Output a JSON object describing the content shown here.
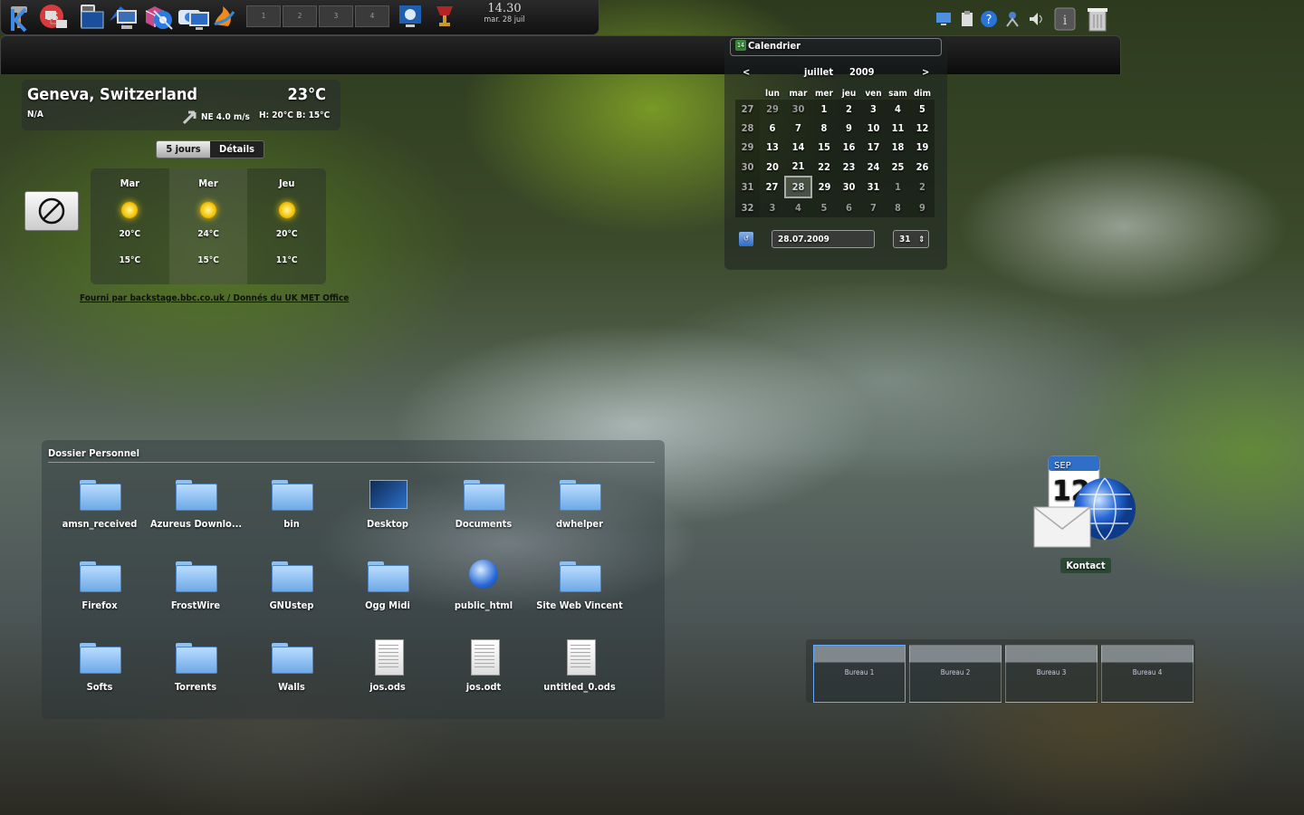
{
  "top_panel": {
    "launchers": [
      "hammer-icon",
      "cs-icon",
      "calculator-icon",
      "bird-icon",
      "package-icon",
      "camera-icon",
      "flame-icon"
    ],
    "pager": [
      "1",
      "2",
      "3",
      "4"
    ],
    "clock": {
      "time": "14.30",
      "date": "mar. 28 juil"
    }
  },
  "weather": {
    "city": "Geneva, Switzerland",
    "temperature": "23°C",
    "condition": "N/A",
    "wind": "NE 4.0 m/s",
    "high_low": "H: 20°C B: 15°C",
    "tabs": [
      "5 jours",
      "Détails"
    ],
    "forecast": [
      {
        "day": "Mar",
        "high": "20°C",
        "low": "15°C"
      },
      {
        "day": "Mer",
        "high": "24°C",
        "low": "15°C"
      },
      {
        "day": "Jeu",
        "high": "20°C",
        "low": "11°C"
      }
    ],
    "credit": "Fourni par backstage.bbc.co.uk / Donnés du UK MET Office"
  },
  "calendar": {
    "title": "Calendrier",
    "prev": "<",
    "next": ">",
    "month": "juillet",
    "year": "2009",
    "weekdays": [
      "lun",
      "mar",
      "mer",
      "jeu",
      "ven",
      "sam",
      "dim"
    ],
    "weeks": [
      {
        "num": "27",
        "days": [
          "29",
          "30",
          "1",
          "2",
          "3",
          "4",
          "5"
        ]
      },
      {
        "num": "28",
        "days": [
          "6",
          "7",
          "8",
          "9",
          "10",
          "11",
          "12"
        ]
      },
      {
        "num": "29",
        "days": [
          "13",
          "14",
          "15",
          "16",
          "17",
          "18",
          "19"
        ]
      },
      {
        "num": "30",
        "days": [
          "20",
          "21",
          "22",
          "23",
          "24",
          "25",
          "26"
        ]
      },
      {
        "num": "31",
        "days": [
          "27",
          "28",
          "29",
          "30",
          "31",
          "1",
          "2"
        ]
      },
      {
        "num": "32",
        "days": [
          "3",
          "4",
          "5",
          "6",
          "7",
          "8",
          "9"
        ]
      }
    ],
    "date_value": "28.07.2009",
    "week_value": "31"
  },
  "folder_view": {
    "title": "Dossier Personnel",
    "items": [
      {
        "name": "amsn_received",
        "type": "folder"
      },
      {
        "name": "Azureus Downlo...",
        "type": "folder"
      },
      {
        "name": "bin",
        "type": "folder"
      },
      {
        "name": "Desktop",
        "type": "desktop"
      },
      {
        "name": "Documents",
        "type": "folder"
      },
      {
        "name": "dwhelper",
        "type": "folder"
      },
      {
        "name": "Firefox",
        "type": "folder"
      },
      {
        "name": "FrostWire",
        "type": "folder"
      },
      {
        "name": "GNUstep",
        "type": "folder"
      },
      {
        "name": "Ogg Midi",
        "type": "folder"
      },
      {
        "name": "public_html",
        "type": "web"
      },
      {
        "name": "Site Web Vincent",
        "type": "folder"
      },
      {
        "name": "Softs",
        "type": "folder"
      },
      {
        "name": "Torrents",
        "type": "folder"
      },
      {
        "name": "Walls",
        "type": "folder"
      },
      {
        "name": "jos.ods",
        "type": "doc"
      },
      {
        "name": "jos.odt",
        "type": "doc"
      },
      {
        "name": "untitled_0.ods",
        "type": "doc"
      }
    ]
  },
  "kontact": {
    "label": "Kontact",
    "month_badge": "SEP",
    "day_badge": "12"
  },
  "desktop_pager": [
    "Bureau 1",
    "Bureau 2",
    "Bureau 3",
    "Bureau 4"
  ],
  "bottom_panel": {
    "launchers": [
      "kde-menu-icon",
      "network-icon",
      "terminal-icon",
      "computer-icon",
      "settings-icon",
      "display-icon"
    ],
    "tray": [
      "monitor-icon",
      "clipboard-icon",
      "help-icon",
      "network-tray-icon",
      "volume-icon",
      "info-icon",
      "trash-icon"
    ]
  },
  "colors": {
    "accent": "#2e6cc8",
    "panel": "#111111"
  }
}
